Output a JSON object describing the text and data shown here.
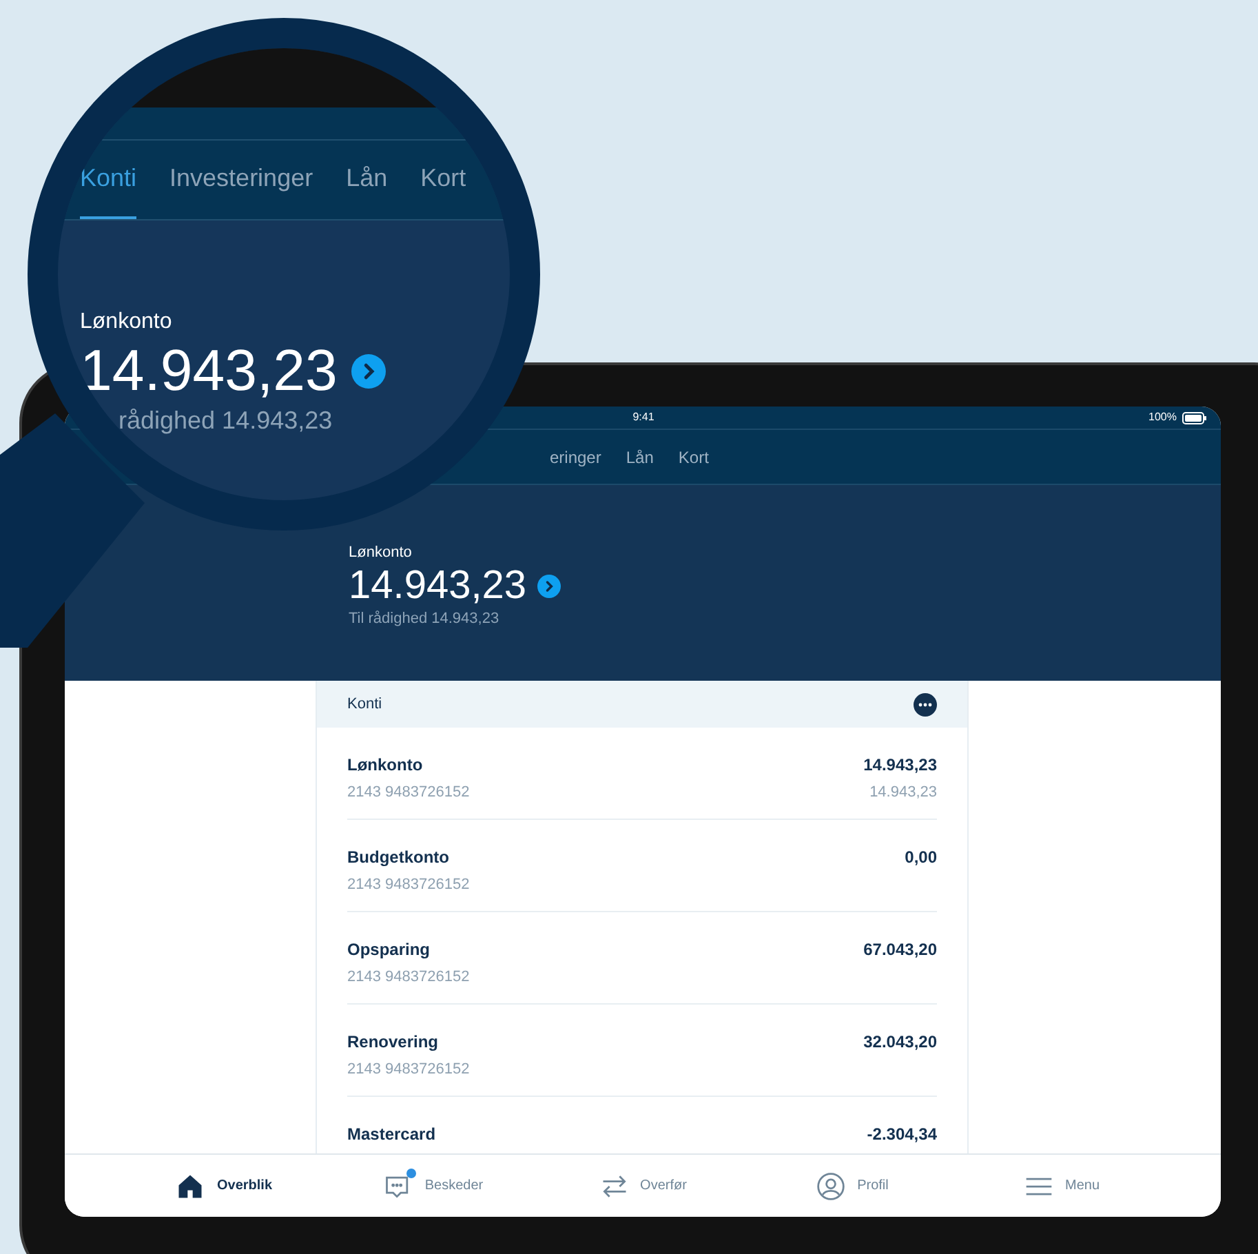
{
  "magnifier": {
    "tabs": [
      {
        "label": "Konti",
        "selected": true
      },
      {
        "label": "Investeringer",
        "selected": false
      },
      {
        "label": "Lån",
        "selected": false
      },
      {
        "label": "Kort",
        "selected": false
      }
    ],
    "account_name": "Lønkonto",
    "balance": "14.943,23",
    "available": "rådighed 14.943,23"
  },
  "status_bar": {
    "time": "9:41",
    "battery": "100%"
  },
  "tabs": [
    {
      "label": "eringer",
      "selected": false
    },
    {
      "label": "Lån",
      "selected": false
    },
    {
      "label": "Kort",
      "selected": false
    }
  ],
  "header": {
    "account_name": "Lønkonto",
    "balance": "14.943,23",
    "available": "Til rådighed 14.943,23"
  },
  "accounts_card": {
    "title": "Konti",
    "rows": [
      {
        "name": "Lønkonto",
        "number": "2143 9483726152",
        "balance": "14.943,23",
        "available": "14.943,23"
      },
      {
        "name": "Budgetkonto",
        "number": "2143 9483726152",
        "balance": "0,00"
      },
      {
        "name": "Opsparing",
        "number": "2143 9483726152",
        "balance": "67.043,20"
      },
      {
        "name": "Renovering",
        "number": "2143 9483726152",
        "balance": "32.043,20"
      },
      {
        "name": "Mastercard",
        "balance": "-2.304,34"
      }
    ]
  },
  "bottom_nav": [
    {
      "kind": "home",
      "label": "Overblik",
      "selected": true,
      "badge": false
    },
    {
      "kind": "messages",
      "label": "Beskeder",
      "selected": false,
      "badge": true
    },
    {
      "kind": "transfer",
      "label": "Overfør",
      "selected": false,
      "badge": false
    },
    {
      "kind": "profile",
      "label": "Profil",
      "selected": false,
      "badge": false
    },
    {
      "kind": "menu",
      "label": "Menu",
      "selected": false,
      "badge": false
    }
  ]
}
